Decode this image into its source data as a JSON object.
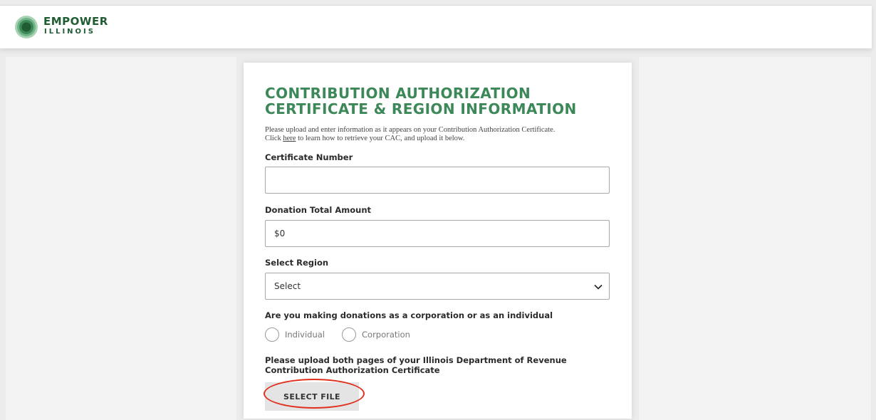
{
  "header": {
    "logo": {
      "line1": "EMPOWER",
      "line2": "ILLINOIS"
    }
  },
  "form": {
    "title_line1": "CONTRIBUTION AUTHORIZATION",
    "title_line2": "CERTIFICATE & REGION INFORMATION",
    "intro_line1": "Please upload and enter information as it appears on your Contribution Authorization Certificate.",
    "intro_click": "Click",
    "intro_link": "here",
    "intro_rest": "to learn how to retrieve your CAC, and upload it below.",
    "certificate_label": "Certificate Number",
    "certificate_value": "",
    "donation_label": "Donation Total Amount",
    "donation_value": "$0",
    "region_label": "Select Region",
    "region_selected": "Select",
    "donor_type_question": "Are you making donations as a corporation or as an individual",
    "donor_type_options": [
      "Individual",
      "Corporation"
    ],
    "upload_label_line1": "Please upload both pages of your Illinois Department of Revenue",
    "upload_label_line2": "Contribution Authorization Certificate",
    "select_file_button": "SELECT FILE"
  },
  "colors": {
    "brand_green": "#3c8858",
    "logo_dark_green": "#1f5c32",
    "highlight_red": "#e0301e"
  },
  "icons": {
    "logo": "empower-illinois-logo-mark",
    "dropdown": "chevron-down-icon"
  }
}
